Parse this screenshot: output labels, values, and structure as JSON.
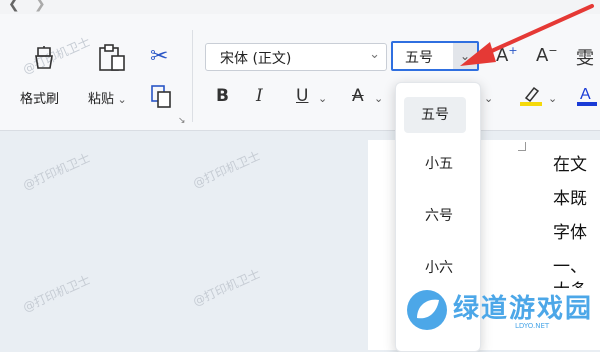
{
  "toolbar": {
    "format_painter_label": "格式刷",
    "paste_label": "粘贴",
    "font_name": "宋体 (正文)",
    "font_size": "五号",
    "bold": "B",
    "italic": "I",
    "underline": "U",
    "strikethrough": "A",
    "partial_glyph": "雯"
  },
  "font_size_dropdown": {
    "options": [
      "五号",
      "小五",
      "六号",
      "小六"
    ],
    "selected": "五号"
  },
  "document": {
    "lines": [
      "在文",
      "本既",
      "字体",
      "一、",
      "大多"
    ]
  },
  "watermark": "@打印机卫士",
  "brand": {
    "name": "绿道游戏园",
    "sub": "LDYO.NET"
  },
  "colors": {
    "accent": "#2f6fe0",
    "arrow": "#e53935",
    "highlight_yellow": "#f5d90a",
    "font_color_blue": "#1a3bd6",
    "brand": "#4ca7e8"
  }
}
